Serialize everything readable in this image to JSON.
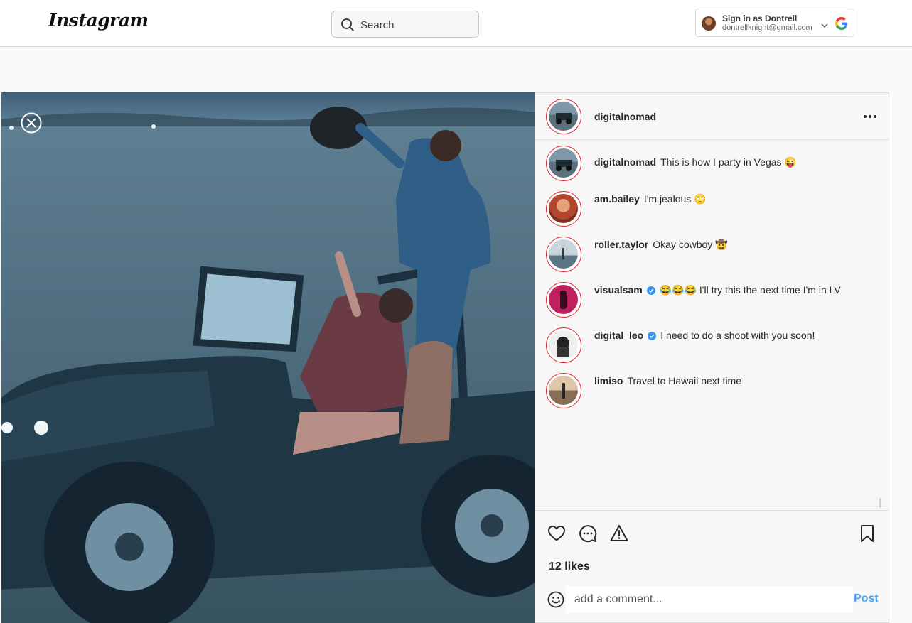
{
  "header": {
    "logo": "Instagram",
    "search_placeholder": "Search",
    "google_account": {
      "title": "Sign in as Dontrell",
      "email": "dontrellknight@gmail.com"
    }
  },
  "post": {
    "author": "digitalnomad",
    "comments": [
      {
        "user": "digitalnomad",
        "verified": false,
        "text": "This is how I party in Vegas 😜"
      },
      {
        "user": "am.bailey",
        "verified": false,
        "text": "I'm jealous 🙄"
      },
      {
        "user": "roller.taylor",
        "verified": false,
        "text": "Okay cowboy 🤠"
      },
      {
        "user": "visualsam",
        "verified": true,
        "text": "😂😂😂 I'll try this the next time I'm in LV"
      },
      {
        "user": "digital_leo",
        "verified": true,
        "text": "I need to do a shoot with you soon!"
      },
      {
        "user": "limiso",
        "verified": false,
        "text": "Travel to Hawaii next time"
      }
    ],
    "likes": "12 likes",
    "comment_placeholder": "add a comment...",
    "post_button": "Post"
  },
  "colors": {
    "story_ring": "#e0252e",
    "verified": "#3897f0",
    "post_button": "#4aa4f4"
  },
  "icons": [
    "search-icon",
    "chevron-down-icon",
    "google-logo-icon",
    "close-icon",
    "more-options-icon",
    "verified-icon",
    "heart-icon",
    "comment-icon",
    "report-icon",
    "bookmark-icon",
    "emoji-icon"
  ]
}
